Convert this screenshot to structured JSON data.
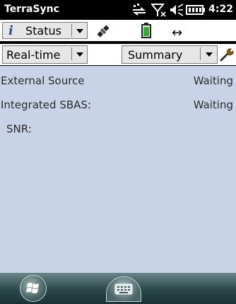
{
  "status_bar": {
    "app_title": "TerraSync",
    "clock": "4:22",
    "icons": [
      "network-sync-icon",
      "no-signal-icon",
      "volume-icon",
      "battery-full-icon"
    ]
  },
  "toolbar": {
    "status_menu_label": "Status",
    "icons": [
      "info-icon",
      "satellite-icon",
      "battery-icon",
      "horizontal-arrows-icon"
    ]
  },
  "view_bar": {
    "mode_label": "Real-time",
    "section_label": "Summary",
    "settings_icon": "wrench-icon"
  },
  "content": {
    "rows": [
      {
        "label": "External Source",
        "value": "Waiting"
      },
      {
        "label": "Integrated SBAS:",
        "value": "Waiting"
      },
      {
        "label": "SNR:",
        "value": ""
      }
    ]
  },
  "taskbar": {
    "icons": [
      "windows-start-icon",
      "keyboard-icon"
    ]
  },
  "colors": {
    "content_bg": "#c9d3e8",
    "status_bar_bg": "#000000",
    "taskbar_bg": "#2a4648"
  }
}
